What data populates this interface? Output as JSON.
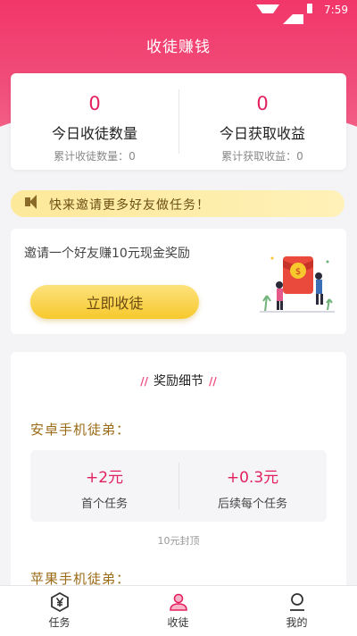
{
  "status_bar": {
    "time": "7:59",
    "icons": [
      "wifi-icon",
      "signal-icon",
      "battery-icon"
    ]
  },
  "header": {
    "title": "收徒赚钱"
  },
  "stats": {
    "today_disciples": {
      "value": "0",
      "label": "今日收徒数量",
      "total": "累计收徒数量：0"
    },
    "today_earnings": {
      "value": "0",
      "label": "今日获取收益",
      "total": "累计获取收益：0"
    }
  },
  "banner": {
    "text": "快来邀请更多好友做任务！",
    "icon": "speaker-icon"
  },
  "invite": {
    "text": "邀请一个好友赚10元现金奖励",
    "button_label": "立即收徒"
  },
  "rewards": {
    "title": "奖励细节",
    "android": {
      "title": "安卓手机徒弟：",
      "first": {
        "amount": "+2元",
        "desc": "首个任务"
      },
      "each": {
        "amount": "+0.3元",
        "desc": "后续每个任务"
      },
      "cap": "10元封顶"
    },
    "ios": {
      "title": "苹果手机徒弟："
    }
  },
  "nav": {
    "tasks": {
      "label": "任务",
      "icon": "yen-coin-icon"
    },
    "recruit": {
      "label": "收徒",
      "icon": "users-icon"
    },
    "mine": {
      "label": "我的",
      "icon": "user-icon"
    }
  },
  "colors": {
    "brand_pink": "#f2366a",
    "accent_red": "#e3205e",
    "gold_button": "#f7c92c",
    "section_gold": "#9a6b16"
  }
}
